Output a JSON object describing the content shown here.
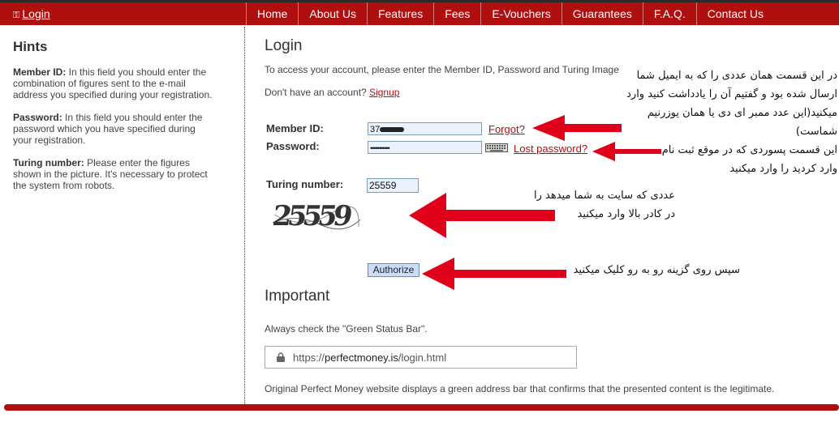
{
  "topbar": {
    "login_label": "Login",
    "nav": [
      "Home",
      "About Us",
      "Features",
      "Fees",
      "E-Vouchers",
      "Guarantees",
      "F.A.Q.",
      "Contact Us"
    ]
  },
  "hints": {
    "title": "Hints",
    "member_id_label": "Member ID:",
    "member_id_text": " In this field you should enter the combination of figures sent to the e-mail address you specified during your registration.",
    "password_label": "Password:",
    "password_text": " In this field you should enter the password which you have specified during your registration.",
    "turing_label": "Turing number:",
    "turing_text": " Please enter the figures shown in the picture. It's necessary to protect the system from robots."
  },
  "login": {
    "title": "Login",
    "intro": "To access your account, please enter the Member ID, Password and Turing Image",
    "no_account": "Don't have an account?",
    "signup": "Signup",
    "member_id_label": "Member ID:",
    "member_id_value": "37",
    "forgot": "Forgot?",
    "password_label": "Password:",
    "password_value": "•••••••••••",
    "lost_password": "Lost password?",
    "turing_label": "Turing number:",
    "turing_value": "25559",
    "captcha_text": "25559",
    "authorize": "Authorize"
  },
  "important": {
    "title": "Important",
    "check_text": "Always check the \"Green Status Bar\".",
    "url_prefix": "https://",
    "url_domain": "perfectmoney.is",
    "url_path": "/login.html",
    "original_text": "Original Perfect Money website displays a green address bar that confirms that the presented content is the legitimate."
  },
  "annotations": {
    "note1_l1": "در این قسمت همان عددی را که به ایمیل شما",
    "note1_l2": "ارسال شده بود و گفتیم آن را یادداشت کنید وارد",
    "note1_l3": "میکنید(این عدد ممبر ای دی یا همان یوزرنیم",
    "note1_l4": "شماست)",
    "note2_l1": "این قسمت پسوردی که در موقع ثبت نام",
    "note2_l2": "وارد کردید را وارد میکنید",
    "note3_l1": "عددی که سایت به شما میدهد را",
    "note3_l2": "در کادر بالا وارد میکنید",
    "note4": "سپس روی گزینه رو به رو کلیک میکنید"
  },
  "colors": {
    "brand_red": "#b00f0f",
    "arrow_red": "#e0001a"
  }
}
